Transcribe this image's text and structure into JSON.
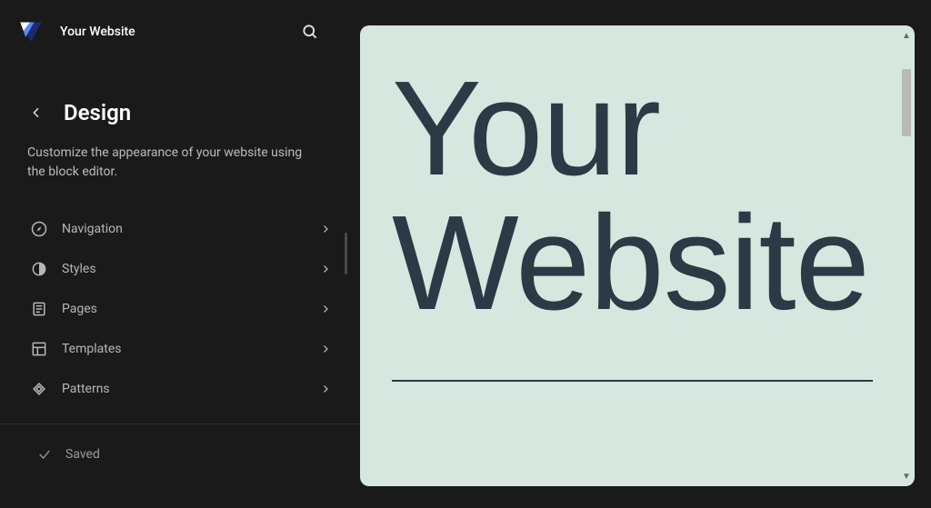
{
  "header": {
    "site_title": "Your Website"
  },
  "section": {
    "title": "Design",
    "description": "Customize the appearance of your website using the block editor."
  },
  "menu": {
    "items": [
      {
        "icon": "compass-icon",
        "label": "Navigation"
      },
      {
        "icon": "half-circle-icon",
        "label": "Styles"
      },
      {
        "icon": "page-icon",
        "label": "Pages"
      },
      {
        "icon": "layout-icon",
        "label": "Templates"
      },
      {
        "icon": "diamond-icon",
        "label": "Patterns"
      }
    ]
  },
  "footer": {
    "saved_label": "Saved"
  },
  "preview": {
    "heading": "Your Website"
  },
  "colors": {
    "preview_bg": "#d6e7e0",
    "preview_text": "#2b3a44",
    "sidebar_bg": "#1a1a1a"
  }
}
